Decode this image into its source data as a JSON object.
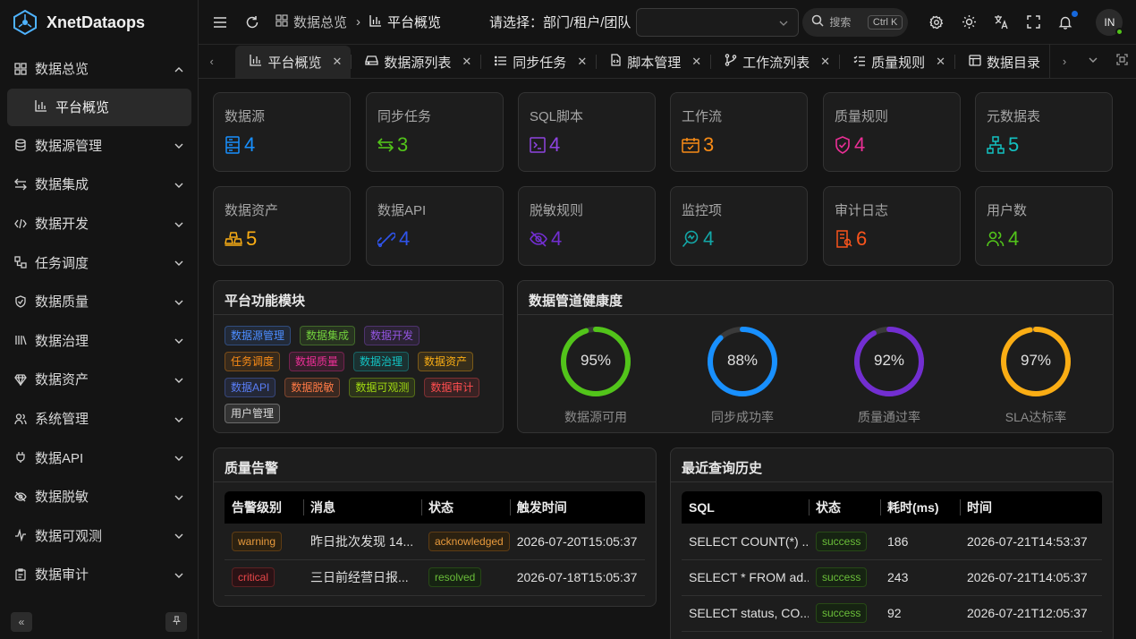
{
  "app": {
    "name": "XnetDataops"
  },
  "colors": {
    "accent": "#1668dc",
    "bg": "#141414",
    "card": "#1d1d1d"
  },
  "header": {
    "breadcrumb": [
      "数据总览",
      "平台概览"
    ],
    "selector_label": "请选择：部门/租户/团队",
    "search_placeholder": "搜索",
    "search_shortcut": "Ctrl K",
    "avatar_initials": "IN"
  },
  "sidebar": {
    "items": [
      {
        "label": "数据总览",
        "icon": "dashboard-icon",
        "expanded": true,
        "children": [
          {
            "label": "平台概览",
            "icon": "bar-chart-icon"
          }
        ]
      },
      {
        "label": "数据源管理",
        "icon": "database-icon"
      },
      {
        "label": "数据集成",
        "icon": "swap-icon"
      },
      {
        "label": "数据开发",
        "icon": "code-icon"
      },
      {
        "label": "任务调度",
        "icon": "schedule-icon"
      },
      {
        "label": "数据质量",
        "icon": "shield-check-icon"
      },
      {
        "label": "数据治理",
        "icon": "library-icon"
      },
      {
        "label": "数据资产",
        "icon": "diamond-icon"
      },
      {
        "label": "系统管理",
        "icon": "users-icon"
      },
      {
        "label": "数据API",
        "icon": "plug-icon"
      },
      {
        "label": "数据脱敏",
        "icon": "eye-off-icon"
      },
      {
        "label": "数据可观测",
        "icon": "pulse-icon"
      },
      {
        "label": "数据审计",
        "icon": "clipboard-icon"
      }
    ]
  },
  "tabs": [
    {
      "label": "平台概览",
      "icon": "bar-chart-icon",
      "active": true
    },
    {
      "label": "数据源列表",
      "icon": "drive-icon"
    },
    {
      "label": "同步任务",
      "icon": "list-icon"
    },
    {
      "label": "脚本管理",
      "icon": "file-code-icon"
    },
    {
      "label": "工作流列表",
      "icon": "branch-icon"
    },
    {
      "label": "质量规则",
      "icon": "list-check-icon"
    },
    {
      "label": "数据目录",
      "icon": "table-icon"
    }
  ],
  "stats": [
    {
      "title": "数据源",
      "value": "4",
      "color": "#1890ff",
      "icon": "server-icon"
    },
    {
      "title": "同步任务",
      "value": "3",
      "color": "#52c41a",
      "icon": "sync-icon"
    },
    {
      "title": "SQL脚本",
      "value": "4",
      "color": "#8e44e0",
      "icon": "terminal-icon"
    },
    {
      "title": "工作流",
      "value": "3",
      "color": "#fa8c16",
      "icon": "calendar-check-icon"
    },
    {
      "title": "质量规则",
      "value": "4",
      "color": "#eb2f96",
      "icon": "shield-check-icon"
    },
    {
      "title": "元数据表",
      "value": "5",
      "color": "#13c2c2",
      "icon": "sitemap-icon"
    },
    {
      "title": "数据资产",
      "value": "5",
      "color": "#faad14",
      "icon": "assets-icon"
    },
    {
      "title": "数据API",
      "value": "4",
      "color": "#2f54eb",
      "icon": "link-icon"
    },
    {
      "title": "脱敏规则",
      "value": "4",
      "color": "#722ed1",
      "icon": "eye-off-icon"
    },
    {
      "title": "监控项",
      "value": "4",
      "color": "#13a8a8",
      "icon": "monitor-search-icon"
    },
    {
      "title": "审计日志",
      "value": "6",
      "color": "#fa541c",
      "icon": "audit-doc-icon"
    },
    {
      "title": "用户数",
      "value": "4",
      "color": "#52c41a",
      "icon": "team-icon"
    }
  ],
  "modules": {
    "title": "平台功能模块",
    "tags": [
      {
        "label": "数据源管理",
        "color": "#4c8dff"
      },
      {
        "label": "数据集成",
        "color": "#73d13d"
      },
      {
        "label": "数据开发",
        "color": "#9254de"
      },
      {
        "label": "任务调度",
        "color": "#fa8c16"
      },
      {
        "label": "数据质量",
        "color": "#eb2f96"
      },
      {
        "label": "数据治理",
        "color": "#13c2c2"
      },
      {
        "label": "数据资产",
        "color": "#faad14"
      },
      {
        "label": "数据API",
        "color": "#597ef7"
      },
      {
        "label": "数据脱敏",
        "color": "#ff7a45"
      },
      {
        "label": "数据可观测",
        "color": "#a0d911"
      },
      {
        "label": "数据审计",
        "color": "#ff4d4f"
      },
      {
        "label": "用户管理",
        "color": "#d9d9d9"
      }
    ]
  },
  "health": {
    "title": "数据管道健康度",
    "gauges": [
      {
        "label": "数据源可用",
        "percent": 95,
        "text": "95%",
        "color": "#52c41a"
      },
      {
        "label": "同步成功率",
        "percent": 88,
        "text": "88%",
        "color": "#1890ff"
      },
      {
        "label": "质量通过率",
        "percent": 92,
        "text": "92%",
        "color": "#722ed1"
      },
      {
        "label": "SLA达标率",
        "percent": 97,
        "text": "97%",
        "color": "#faad14"
      }
    ]
  },
  "alerts": {
    "title": "质量告警",
    "columns": [
      "告警级别",
      "消息",
      "状态",
      "触发时间"
    ],
    "rows": [
      {
        "level": "warning",
        "message": "昨日批次发现 14...",
        "status": "acknowledged",
        "time": "2026-07-20T15:05:37"
      },
      {
        "level": "critical",
        "message": "三日前经营日报...",
        "status": "resolved",
        "time": "2026-07-18T15:05:37"
      }
    ]
  },
  "queries": {
    "title": "最近查询历史",
    "columns": [
      "SQL",
      "状态",
      "耗时(ms)",
      "时间"
    ],
    "rows": [
      {
        "sql": "SELECT COUNT(*) ...",
        "status": "success",
        "ms": "186",
        "time": "2026-07-21T14:53:37"
      },
      {
        "sql": "SELECT * FROM ad...",
        "status": "success",
        "ms": "243",
        "time": "2026-07-21T14:05:37"
      },
      {
        "sql": "SELECT status, CO...",
        "status": "success",
        "ms": "92",
        "time": "2026-07-21T12:05:37"
      }
    ]
  }
}
